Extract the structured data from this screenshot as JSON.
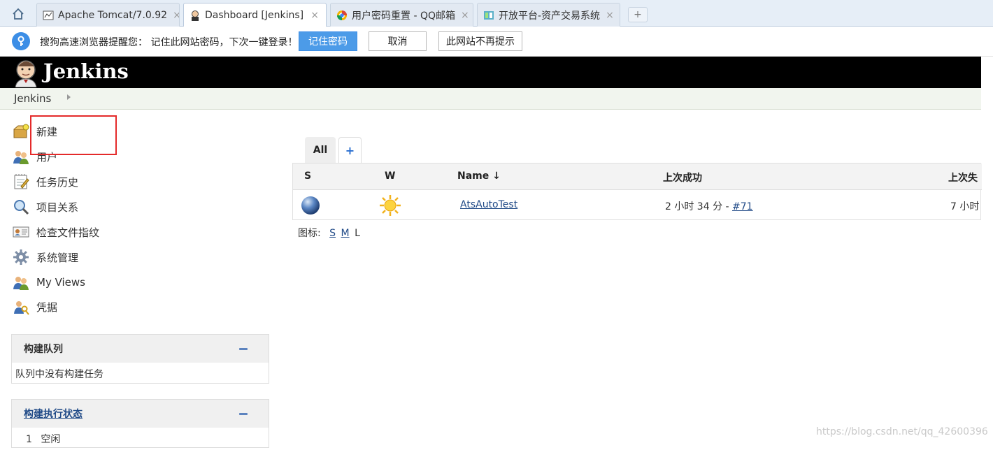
{
  "browser": {
    "tabs": [
      {
        "title": "Apache Tomcat/7.0.92",
        "icon": "tomcat-icon"
      },
      {
        "title": "Dashboard [Jenkins]",
        "icon": "jenkins-icon"
      },
      {
        "title": "用户密码重置 - QQ邮箱",
        "icon": "qqmail-icon"
      },
      {
        "title": "开放平台-资产交易系统",
        "icon": "asset-icon"
      }
    ],
    "close_glyph": "×",
    "new_tab_glyph": "+"
  },
  "password_bar": {
    "message": "搜狗高速浏览器提醒您： 记住此网站密码，下次一键登录！",
    "remember_label": "记住密码",
    "cancel_label": "取消",
    "never_label": "此网站不再提示",
    "accent": "#4c9be8"
  },
  "header": {
    "title": "Jenkins"
  },
  "breadcrumb": {
    "items": [
      "Jenkins"
    ]
  },
  "sidebar": {
    "tasks": [
      {
        "label": "新建",
        "icon": "new-item-icon"
      },
      {
        "label": "用户",
        "icon": "users-icon"
      },
      {
        "label": "任务历史",
        "icon": "notepad-icon"
      },
      {
        "label": "项目关系",
        "icon": "search-icon"
      },
      {
        "label": "检查文件指纹",
        "icon": "fingerprint-icon"
      },
      {
        "label": "系统管理",
        "icon": "gear-icon"
      },
      {
        "label": "My Views",
        "icon": "users-icon"
      },
      {
        "label": "凭据",
        "icon": "credentials-icon"
      }
    ]
  },
  "build_queue": {
    "title": "构建队列",
    "empty_text": "队列中没有构建任务"
  },
  "executor_status": {
    "title": "构建执行状态",
    "rows": [
      {
        "num": "1",
        "state": "空闲"
      }
    ]
  },
  "views": {
    "tabs": [
      {
        "label": "All"
      },
      {
        "label": "+"
      }
    ]
  },
  "projects_table": {
    "headers": [
      "S",
      "W",
      "Name ↓",
      "上次成功",
      "上次失"
    ],
    "rows": [
      {
        "status_icon": "blue-ball-icon",
        "weather_icon": "sunny-icon",
        "name": "AtsAutoTest",
        "last_success_prefix": "2 小时 34 分 - ",
        "last_success_link": "#71",
        "last_failure": "7 小时"
      }
    ]
  },
  "icon_legend": {
    "label": "图标:",
    "sizes": [
      "S",
      "M",
      "L"
    ]
  },
  "watermark": "https://blog.csdn.net/qq_42600396"
}
